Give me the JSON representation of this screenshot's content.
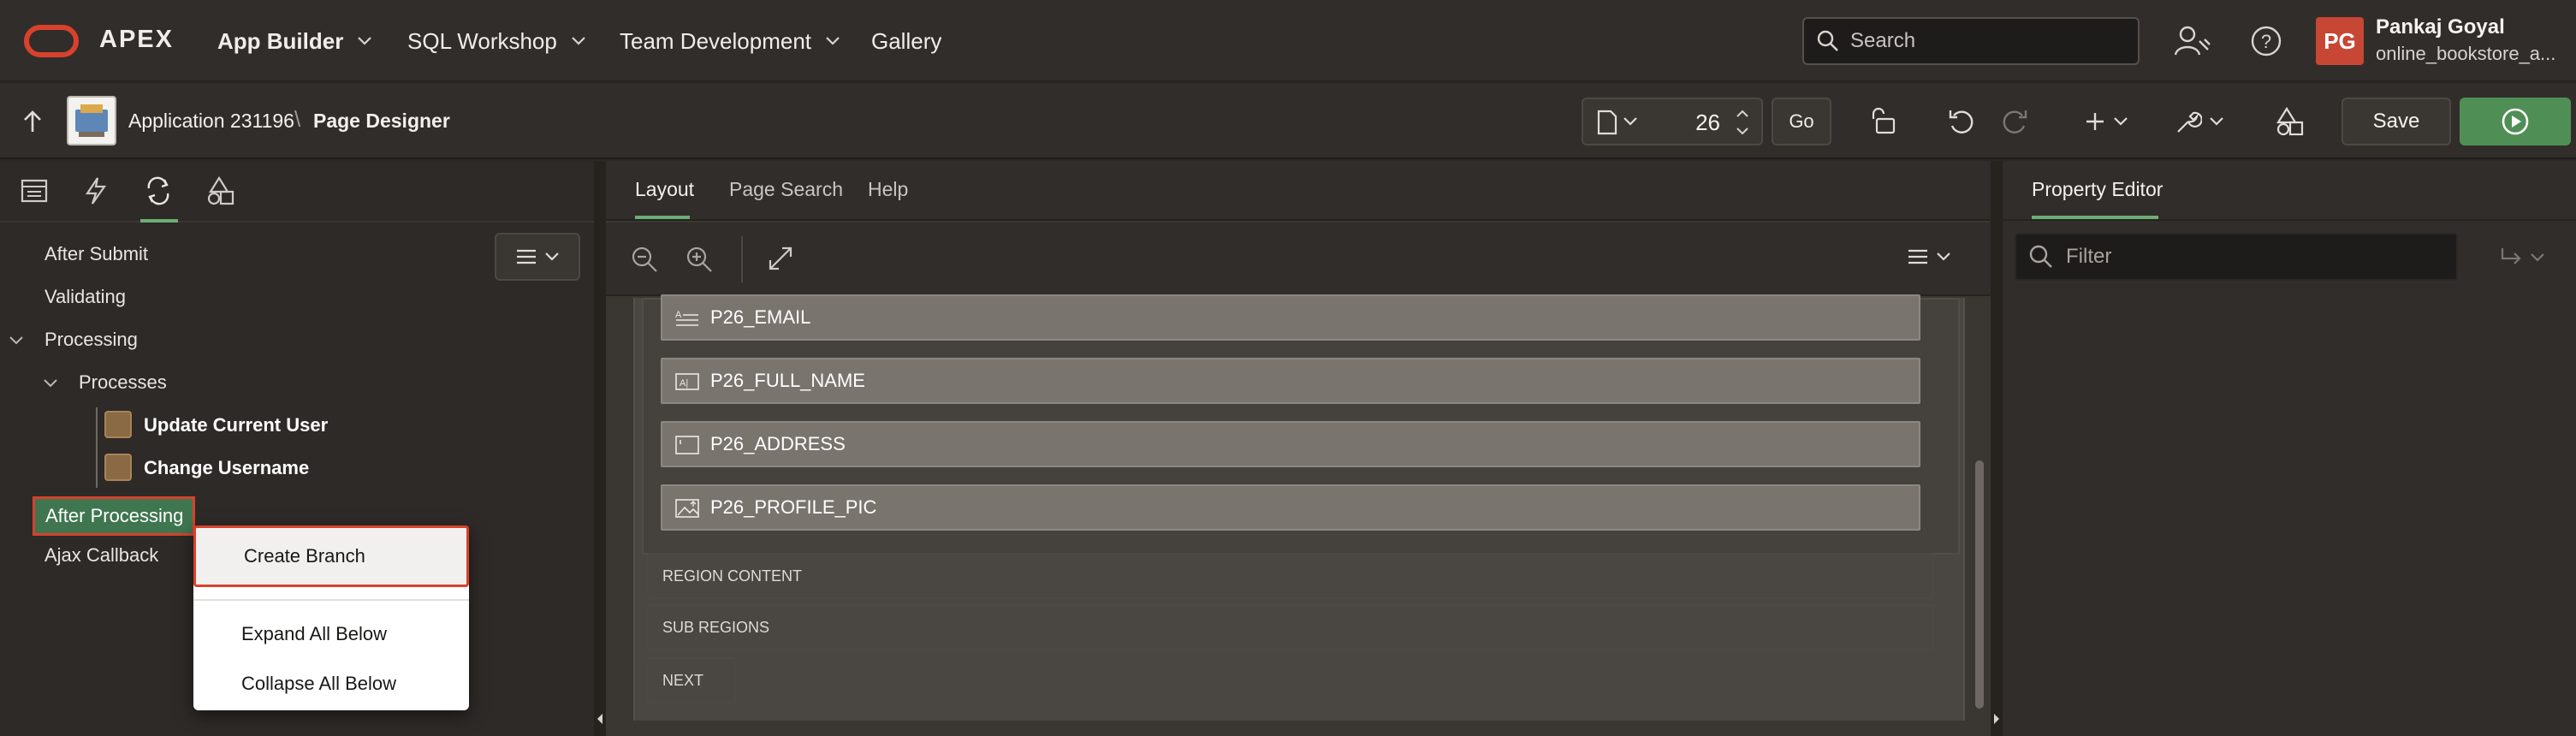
{
  "colors": {
    "accent_green": "#6cae75",
    "highlight_red": "#d9412c",
    "oracle_red": "#c74634",
    "run_green": "#4f8f56"
  },
  "header": {
    "brand": "APEX",
    "nav": [
      "App Builder",
      "SQL Workshop",
      "Team Development",
      "Gallery"
    ],
    "search_placeholder": "Search",
    "user": {
      "initials": "PG",
      "name": "Pankaj Goyal",
      "workspace": "online_bookstore_a..."
    }
  },
  "toolbar": {
    "application": "Application 231196",
    "separator": "\\",
    "page_designer": "Page Designer",
    "page_number": "26",
    "go_label": "Go",
    "save_label": "Save"
  },
  "left_panel": {
    "tabs": [
      "rendering-icon",
      "dynamic-actions-icon",
      "processing-icon",
      "shared-components-icon"
    ],
    "tree": {
      "after_submit": "After Submit",
      "validating": "Validating",
      "processing": "Processing",
      "processes": "Processes",
      "process_1": "Update Current User",
      "process_2": "Change Username",
      "after_processing": "After Processing",
      "ajax_callback": "Ajax Callback"
    },
    "context_menu": {
      "create_branch": "Create Branch",
      "expand_all": "Expand All Below",
      "collapse_all": "Collapse All Below"
    }
  },
  "center_panel": {
    "tabs": [
      "Layout",
      "Page Search",
      "Help"
    ],
    "items": [
      "P26_EMAIL",
      "P26_FULL_NAME",
      "P26_ADDRESS",
      "P26_PROFILE_PIC"
    ],
    "regions": [
      "REGION CONTENT",
      "SUB REGIONS",
      "NEXT"
    ]
  },
  "right_panel": {
    "title": "Property Editor",
    "filter_placeholder": "Filter"
  }
}
